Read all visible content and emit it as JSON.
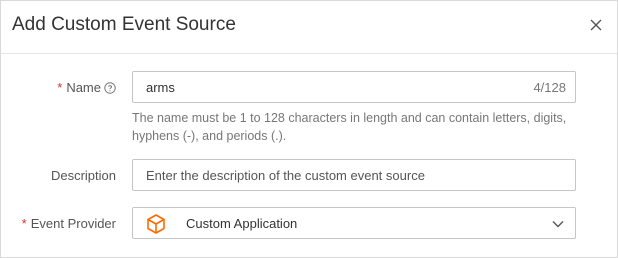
{
  "dialog": {
    "title": "Add Custom Event Source",
    "close_label": "Close"
  },
  "form": {
    "name": {
      "required_mark": "*",
      "label": "Name",
      "value": "arms",
      "counter": "4/128",
      "hint": "The name must be 1 to 128 characters in length and can contain letters, digits, hyphens (-), and periods (.)."
    },
    "description": {
      "label": "Description",
      "placeholder": "Enter the description of the custom event source",
      "value": ""
    },
    "event_provider": {
      "required_mark": "*",
      "label": "Event Provider",
      "selected": "Custom Application",
      "icon": "hexagon-cube-icon"
    }
  },
  "colors": {
    "required": "#d93026",
    "provider_icon": "#ff6a00",
    "border": "#c4c6cf"
  }
}
